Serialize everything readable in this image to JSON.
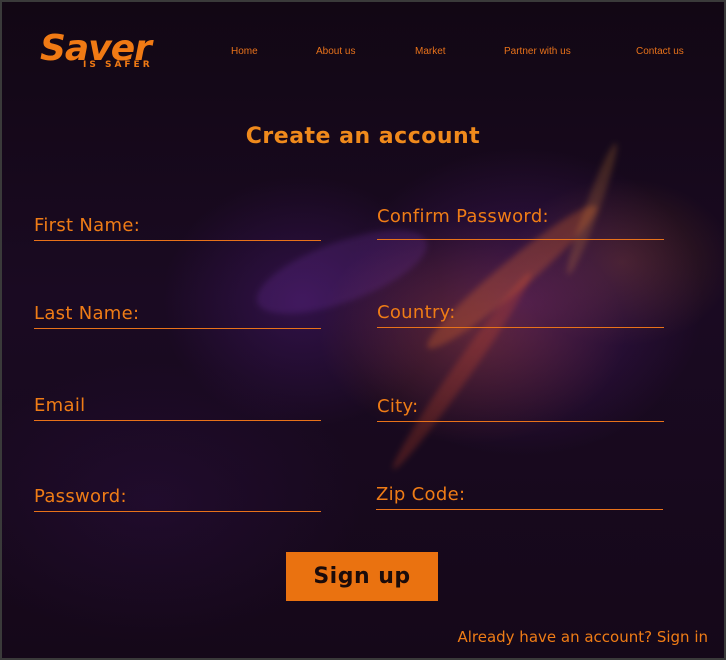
{
  "logo": {
    "main": "Saver",
    "tagline": "IS SAFER"
  },
  "nav": [
    "Home",
    "About us",
    "Market",
    "Partner with us",
    "Contact us"
  ],
  "form": {
    "title": "Create an account",
    "fields": [
      {
        "label": "First Name:"
      },
      {
        "label": "Last Name:"
      },
      {
        "label": "Email"
      },
      {
        "label": "Password:"
      },
      {
        "label": "Confirm Password:"
      },
      {
        "label": "Country:"
      },
      {
        "label": "City:"
      },
      {
        "label": "Zip Code:"
      }
    ],
    "submit_label": "Sign up",
    "signin_link": "Already have an account? Sign in"
  },
  "colors": {
    "accent": "#ea7210",
    "background": "#15091a"
  }
}
